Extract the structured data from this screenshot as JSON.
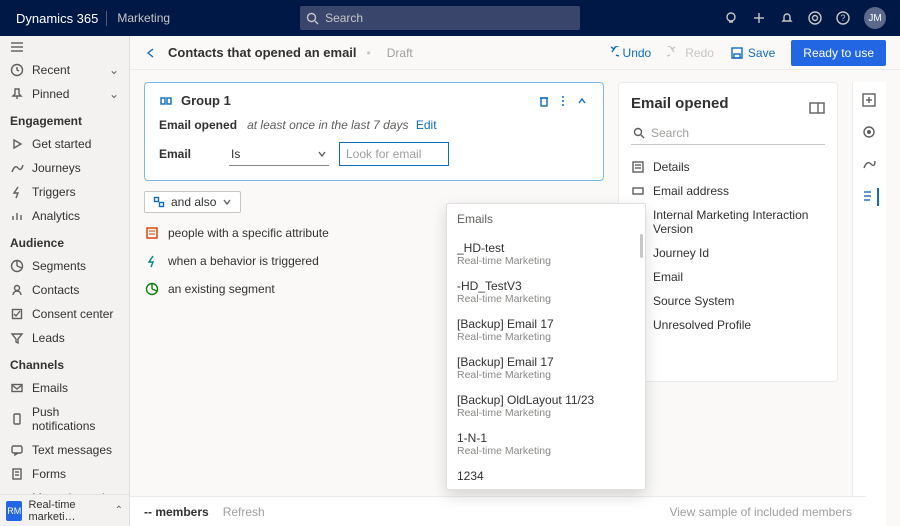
{
  "top": {
    "brand": "Dynamics 365",
    "domain": "Marketing",
    "search_placeholder": "Search",
    "avatar": "JM"
  },
  "leftnav": {
    "recent": "Recent",
    "pinned": "Pinned",
    "sections": {
      "engagement": "Engagement",
      "audience": "Audience",
      "channels": "Channels"
    },
    "items": {
      "get_started": "Get started",
      "journeys": "Journeys",
      "triggers": "Triggers",
      "analytics": "Analytics",
      "segments": "Segments",
      "contacts": "Contacts",
      "consent_center": "Consent center",
      "leads": "Leads",
      "emails": "Emails",
      "push": "Push notifications",
      "text": "Text messages",
      "forms": "Forms",
      "more": "More channels"
    },
    "area_badge": "RM",
    "area_label": "Real-time marketi…"
  },
  "cmdbar": {
    "title": "Contacts that opened an email",
    "status": "Draft",
    "undo": "Undo",
    "redo": "Redo",
    "save": "Save",
    "ready": "Ready to use"
  },
  "group": {
    "title": "Group 1",
    "behavior": "Email opened",
    "qualifier_prefix": "at least once in the last 7 days",
    "edit": "Edit",
    "attribute": "Email",
    "operator": "Is",
    "lookup_placeholder": "Look for email",
    "and_also": "and also"
  },
  "suggestions": {
    "attribute": "people with a specific attribute",
    "behavior": "when a behavior is triggered",
    "segment": "an existing segment"
  },
  "lookup": {
    "heading": "Emails",
    "items": [
      {
        "name": "_HD-test",
        "sub": "Real-time Marketing"
      },
      {
        "name": "-HD_TestV3",
        "sub": "Real-time Marketing"
      },
      {
        "name": "[Backup] Email 17",
        "sub": "Real-time Marketing"
      },
      {
        "name": "[Backup] Email 17",
        "sub": "Real-time Marketing"
      },
      {
        "name": "[Backup] OldLayout 11/23",
        "sub": "Real-time Marketing"
      },
      {
        "name": "1-N-1",
        "sub": "Real-time Marketing"
      },
      {
        "name": "1234",
        "sub": ""
      }
    ]
  },
  "panel": {
    "title": "Email opened",
    "search_placeholder": "Search",
    "items": {
      "details": "Details",
      "email_address": "Email address",
      "interaction_version": "Internal Marketing Interaction Version",
      "journey_id": "Journey Id",
      "email": "Email",
      "source_system": "Source System",
      "unresolved": "Unresolved Profile"
    }
  },
  "footer": {
    "members": "-- members",
    "refresh": "Refresh",
    "view_sample": "View sample of included members"
  }
}
